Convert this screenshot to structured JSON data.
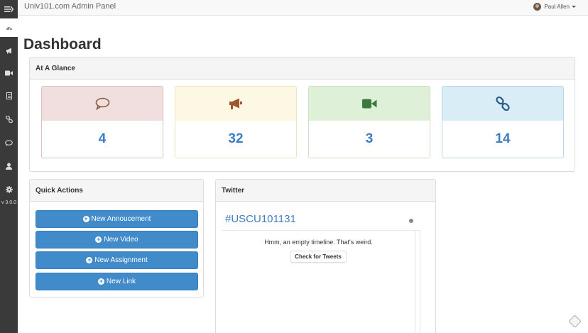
{
  "header": {
    "app_title": "Univ101.com Admin Panel",
    "user_name": "Paul Allen"
  },
  "sidebar": {
    "icons": [
      "menu-toggle-icon",
      "dashboard-icon",
      "bullhorn-icon",
      "video-camera-icon",
      "file-icon",
      "link-icon",
      "comment-icon",
      "user-icon",
      "gear-icon"
    ],
    "version": "v 3.0.0"
  },
  "page": {
    "title": "Dashboard"
  },
  "glance": {
    "heading": "At A Glance",
    "cards": [
      {
        "icon": "comment-icon",
        "value": "4",
        "color": "#8a5a3c"
      },
      {
        "icon": "bullhorn-icon",
        "value": "32",
        "color": "#9a5a2e"
      },
      {
        "icon": "video-camera-icon",
        "value": "3",
        "color": "#3c7a3c"
      },
      {
        "icon": "link-icon",
        "value": "14",
        "color": "#2e5a8a"
      }
    ]
  },
  "quick_actions": {
    "heading": "Quick Actions",
    "buttons": [
      "New Annoucement",
      "New Video",
      "New Assignment",
      "New Link"
    ]
  },
  "twitter": {
    "heading": "Twitter",
    "hashtag": "#USCU101131",
    "empty_message": "Hmm, an empty timeline. That's weird.",
    "check_button": "Check for Tweets"
  },
  "colors": {
    "primary": "#428bca",
    "sidebar_bg": "#3a3a3a",
    "number_blue": "#3d7ec2"
  }
}
